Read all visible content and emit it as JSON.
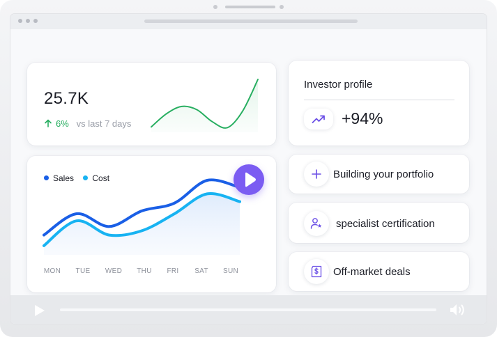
{
  "stat_card": {
    "value": "25.7K",
    "change_percent": "6%",
    "change_suffix": "vs last 7 days",
    "sparkline": [
      6,
      26,
      37,
      32,
      14,
      5,
      30,
      78
    ]
  },
  "chart_card": {
    "legend": [
      {
        "name": "Sales",
        "color": "#1a5fe6"
      },
      {
        "name": "Cost",
        "color": "#18b3f2"
      }
    ],
    "days": [
      "MON",
      "TUE",
      "WED",
      "THU",
      "FRI",
      "SAT",
      "SUN"
    ]
  },
  "chart_data": {
    "type": "line",
    "x": [
      "MON",
      "TUE",
      "WED",
      "THU",
      "FRI",
      "SAT",
      "SUN"
    ],
    "series": [
      {
        "name": "Sales",
        "values": [
          22,
          52,
          34,
          56,
          67,
          99,
          89
        ]
      },
      {
        "name": "Cost",
        "values": [
          7,
          42,
          22,
          28,
          52,
          80,
          69
        ]
      }
    ],
    "legend_position": "top-left",
    "grid": false
  },
  "investor": {
    "title": "Investor profile",
    "value": "+94%"
  },
  "items": [
    {
      "label": "Building your portfolio",
      "icon": "plus-icon"
    },
    {
      "label": "specialist certification",
      "icon": "user-star-icon"
    },
    {
      "label": "Off-market deals",
      "icon": "dollar-document-icon"
    }
  ],
  "colors": {
    "accent": "#7b5cf2",
    "positive": "#27ae60",
    "sales": "#1a5fe6",
    "cost": "#18b3f2"
  }
}
